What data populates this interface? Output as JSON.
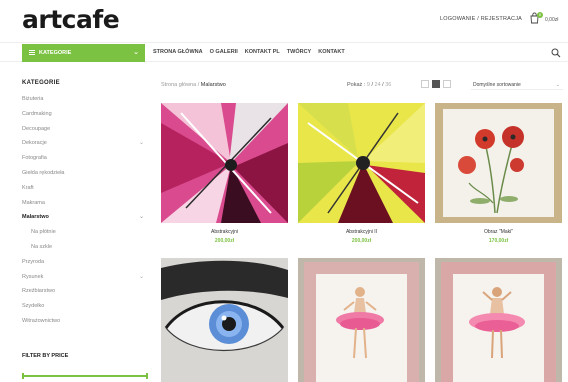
{
  "header": {
    "logo": "artcafe",
    "account_link": "Logowanie / Rejestracja",
    "cart_count": "0",
    "cart_total": "0,00zł"
  },
  "nav": {
    "categories_button": "Kategorie",
    "links": [
      "Strona główna",
      "O galerii",
      "Kontakt pl",
      "Twórcy",
      "Kontakt"
    ]
  },
  "sidebar": {
    "title": "Kategorie",
    "items": [
      {
        "label": "Biżuteria",
        "type": "item"
      },
      {
        "label": "Cardmaking",
        "type": "item"
      },
      {
        "label": "Decoupage",
        "type": "item"
      },
      {
        "label": "Dekoracje",
        "type": "item",
        "expandable": true
      },
      {
        "label": "Fotografia",
        "type": "item"
      },
      {
        "label": "Giełda rękodzieła",
        "type": "item"
      },
      {
        "label": "Kraft",
        "type": "item"
      },
      {
        "label": "Makrama",
        "type": "item"
      },
      {
        "label": "Malarstwo",
        "type": "active",
        "expandable": true
      },
      {
        "label": "Na płótnie",
        "type": "sub"
      },
      {
        "label": "Na szkle",
        "type": "sub"
      },
      {
        "label": "Przyroda",
        "type": "item"
      },
      {
        "label": "Rysunek",
        "type": "item",
        "expandable": true
      },
      {
        "label": "Rzeźbiarstwo",
        "type": "item"
      },
      {
        "label": "Szydełko",
        "type": "item"
      },
      {
        "label": "Witrażownictwo",
        "type": "item"
      }
    ],
    "filter_title": "Filter by price"
  },
  "toolbar": {
    "breadcrumb_home": "Strona główna",
    "breadcrumb_sep": " / ",
    "breadcrumb_current": "Malarstwo",
    "perpage_label": "Pokaż :",
    "perpage_options": [
      "9",
      "24",
      "36"
    ],
    "sort_label": "Domyślne sortowanie"
  },
  "products": [
    {
      "name": "Abstrakcyjni",
      "price": "200,00zł"
    },
    {
      "name": "Abstrakcyjni II",
      "price": "200,00zł"
    },
    {
      "name": "Obraz \"Maki\"",
      "price": "170,00zł"
    },
    {
      "name": "",
      "price": ""
    },
    {
      "name": "",
      "price": ""
    },
    {
      "name": "",
      "price": ""
    }
  ],
  "colors": {
    "accent": "#7cc242"
  }
}
